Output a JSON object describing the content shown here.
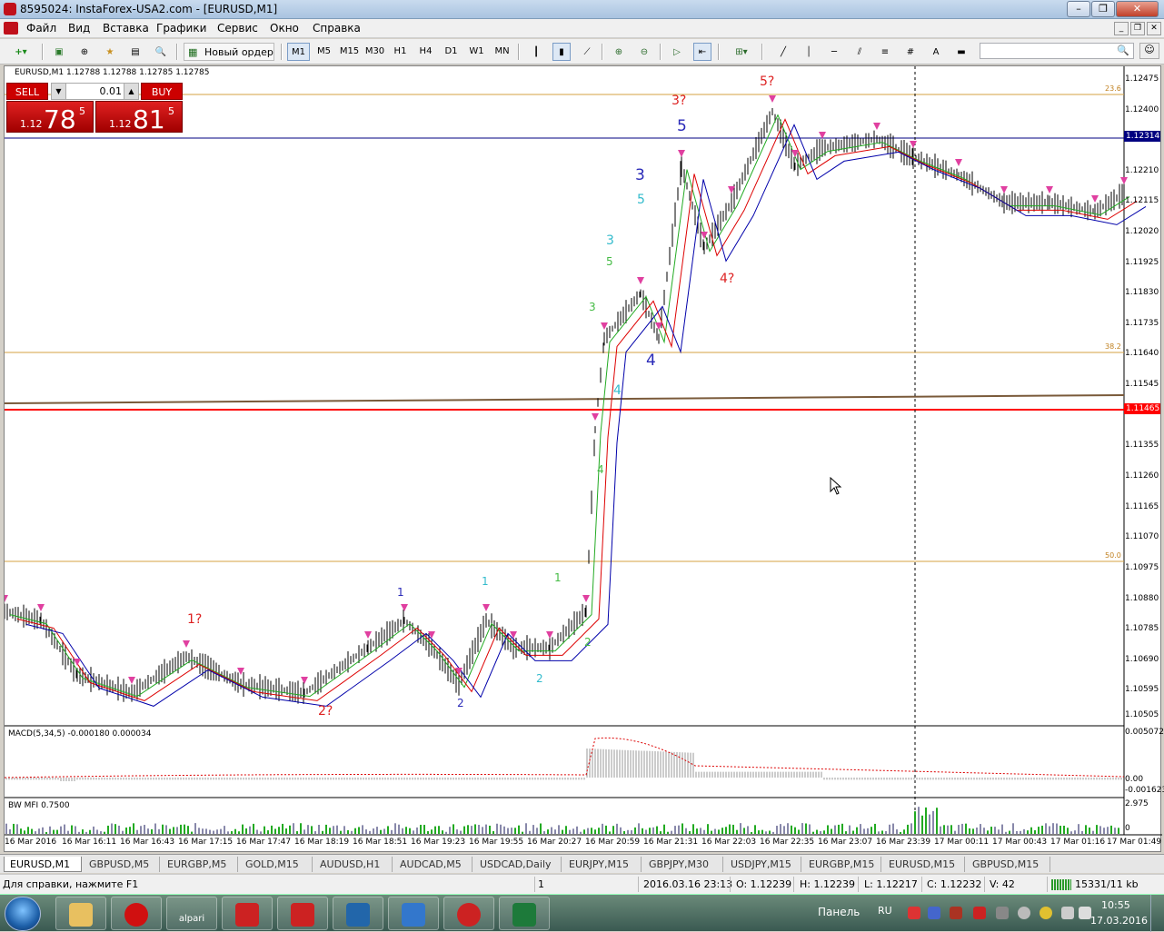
{
  "window": {
    "title": "8595024: InstaForex-USA2.com - [EURUSD,M1]",
    "min": "–",
    "max": "❐",
    "close": "✕"
  },
  "menu": [
    "Файл",
    "Вид",
    "Вставка",
    "Графики",
    "Сервис",
    "Окно",
    "Справка"
  ],
  "toolbar": {
    "new_order": "Новый ордер",
    "timeframes": [
      "M1",
      "M5",
      "M15",
      "M30",
      "H1",
      "H4",
      "D1",
      "W1",
      "MN"
    ],
    "active_timeframe": "M1",
    "text_tool": "A"
  },
  "chart": {
    "symbol_line": "EURUSD,M1  1.12788 1.12788 1.12785 1.12785",
    "one_click": {
      "sell_label": "SELL",
      "buy_label": "BUY",
      "lot": "0.01",
      "sell_prefix": "1.12",
      "sell_big": "78",
      "sell_sup": "5",
      "buy_prefix": "1.12",
      "buy_big": "81",
      "buy_sup": "5"
    },
    "price_axis": [
      "1.12475",
      "1.12400",
      "1.12314",
      "1.12210",
      "1.12115",
      "1.12020",
      "1.11925",
      "1.11830",
      "1.11735",
      "1.11640",
      "1.11545",
      "1.11465",
      "1.11355",
      "1.11260",
      "1.11165",
      "1.11070",
      "1.10975",
      "1.10880",
      "1.10785",
      "1.10690",
      "1.10595",
      "1.10505"
    ],
    "current_bid_label": "1.12314",
    "red_line_label": "1.11465",
    "fib_levels": [
      "23.6",
      "38.2",
      "50.0"
    ],
    "time_axis": [
      "16 Mar 2016",
      "16 Mar 16:11",
      "16 Mar 16:43",
      "16 Mar 17:15",
      "16 Mar 17:47",
      "16 Mar 18:19",
      "16 Mar 18:51",
      "16 Mar 19:23",
      "16 Mar 19:55",
      "16 Mar 20:27",
      "16 Mar 20:59",
      "16 Mar 21:31",
      "16 Mar 22:03",
      "16 Mar 22:35",
      "16 Mar 23:07",
      "16 Mar 23:39",
      "17 Mar 00:11",
      "17 Mar 00:43",
      "17 Mar 01:16",
      "17 Mar 01:49"
    ],
    "wave_labels": [
      {
        "text": "1?",
        "color": "#dd2222"
      },
      {
        "text": "2?",
        "color": "#dd2222"
      },
      {
        "text": "1",
        "color": "#2a2ab8"
      },
      {
        "text": "2",
        "color": "#2a2ab8"
      },
      {
        "text": "1",
        "color": "#33bbcc"
      },
      {
        "text": "2",
        "color": "#33bbcc"
      },
      {
        "text": "1",
        "color": "#44bb44"
      },
      {
        "text": "2",
        "color": "#44bb44"
      },
      {
        "text": "3",
        "color": "#44bb44"
      },
      {
        "text": "4",
        "color": "#44bb44"
      },
      {
        "text": "5",
        "color": "#44bb44"
      },
      {
        "text": "3",
        "color": "#33bbcc"
      },
      {
        "text": "4",
        "color": "#33bbcc"
      },
      {
        "text": "5",
        "color": "#33bbcc"
      },
      {
        "text": "3",
        "color": "#2a2ab8"
      },
      {
        "text": "4",
        "color": "#2a2ab8"
      },
      {
        "text": "5",
        "color": "#2a2ab8"
      },
      {
        "text": "3?",
        "color": "#dd2222"
      },
      {
        "text": "4?",
        "color": "#dd2222"
      },
      {
        "text": "5?",
        "color": "#dd2222"
      }
    ],
    "macd_title": "MACD(5,34,5) -0.000180 0.000034",
    "macd_axis": [
      "0.005072",
      "0.00",
      "-0.001623"
    ],
    "mfi_title": "BW MFI 0.7500",
    "mfi_axis": [
      "2.975",
      "0"
    ]
  },
  "chart_tabs": [
    "EURUSD,M1",
    "GBPUSD,M5",
    "EURGBP,M5",
    "GOLD,M15",
    "AUDUSD,H1",
    "AUDCAD,M5",
    "USDCAD,Daily",
    "EURJPY,M15",
    "GBPJPY,M30",
    "USDJPY,M15",
    "EURGBP,M15",
    "EURUSD,M15",
    "GBPUSD,M15"
  ],
  "status": {
    "help": "Для справки, нажмите F1",
    "profile": "1",
    "datetime": "2016.03.16 23:13",
    "open": "O: 1.12239",
    "high": "H: 1.12239",
    "low": "L: 1.12217",
    "close": "C: 1.12232",
    "volume": "V: 42",
    "traffic": "15331/11 kb"
  },
  "taskbar": {
    "panel_label": "Панель",
    "lang": "RU",
    "time": "10:55",
    "date": "17.03.2016",
    "apps": [
      {
        "name": "file-explorer",
        "color": "#e8c060"
      },
      {
        "name": "opera",
        "color": "#d01010"
      },
      {
        "name": "alpari",
        "color": "#3a7a3a",
        "label": "alpari"
      },
      {
        "name": "terminal-1",
        "color": "#cc2222"
      },
      {
        "name": "terminal-2",
        "color": "#cc2222"
      },
      {
        "name": "charts-app",
        "color": "#2266aa"
      },
      {
        "name": "p-app",
        "color": "#3377cc"
      },
      {
        "name": "g-app",
        "color": "#cc2222"
      },
      {
        "name": "excel",
        "color": "#1d7a3a"
      }
    ]
  },
  "colors": {
    "accent_red": "#cc0000",
    "bid_line": "#000080",
    "red_hline": "#ff0000",
    "fib": "#d4a040"
  }
}
